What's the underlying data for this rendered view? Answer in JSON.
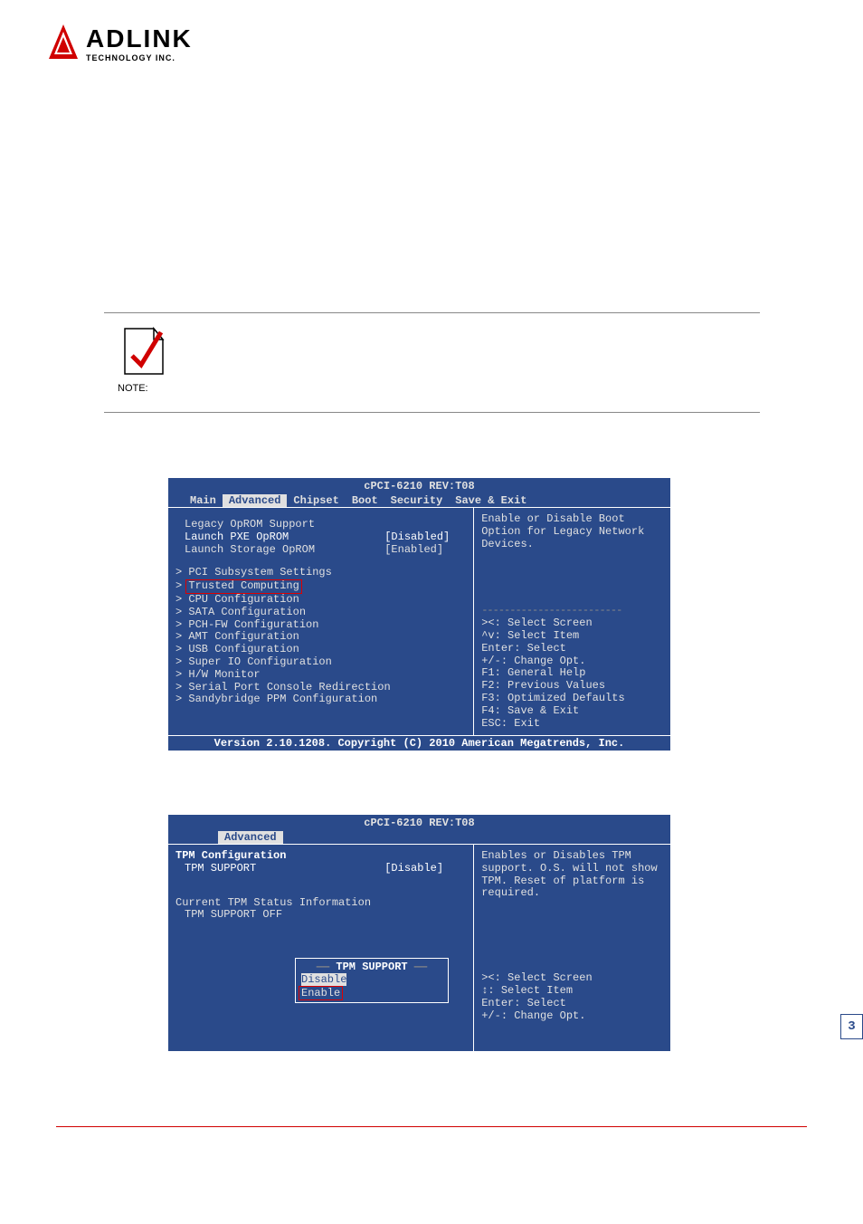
{
  "logo": {
    "main": "ADLINK",
    "sub": "TECHNOLOGY INC."
  },
  "note_label": "NOTE:",
  "bios1": {
    "title": "cPCI-6210 REV:T08",
    "menu": [
      "Main",
      "Advanced",
      "Chipset",
      "Boot",
      "Security",
      "Save & Exit"
    ],
    "active_menu_index": 1,
    "left": {
      "heading1": "Legacy OpROM Support",
      "pxe_label": "Launch PXE OpROM",
      "pxe_val": "[Disabled]",
      "storage_label": "Launch Storage OpROM",
      "storage_val": "[Enabled]",
      "submenus": [
        "PCI Subsystem Settings",
        "Trusted Computing",
        "CPU Configuration",
        "SATA Configuration",
        "PCH-FW Configuration",
        "AMT Configuration",
        "USB Configuration",
        "Super IO Configuration",
        "H/W Monitor",
        "Serial Port Console Redirection",
        "Sandybridge PPM Configuration"
      ]
    },
    "right": {
      "help": "Enable or Disable Boot Option for Legacy Network Devices.",
      "keys": [
        "><: Select Screen",
        "^v: Select Item",
        "Enter: Select",
        "+/-: Change Opt.",
        "F1: General Help",
        "F2: Previous Values",
        "F3: Optimized Defaults",
        "F4: Save & Exit",
        "ESC: Exit"
      ]
    },
    "footer": "Version 2.10.1208. Copyright (C) 2010 American Megatrends, Inc."
  },
  "bios2": {
    "title": "cPCI-6210 REV:T08",
    "active_menu": "Advanced",
    "left": {
      "heading": "TPM Configuration",
      "support_label": "TPM SUPPORT",
      "support_val": "[Disable]",
      "status_heading": "Current TPM Status Information",
      "status_line": "TPM SUPPORT OFF"
    },
    "right": {
      "help": "Enables or Disables TPM support. O.S. will not show TPM. Reset of platform is required.",
      "keys": [
        "><: Select Screen",
        "↕: Select Item",
        "Enter: Select",
        "+/-: Change Opt."
      ]
    },
    "popup": {
      "title": "TPM SUPPORT",
      "options": [
        "Disable",
        "Enable"
      ],
      "selected_index": 0
    }
  },
  "page_mark": "3"
}
